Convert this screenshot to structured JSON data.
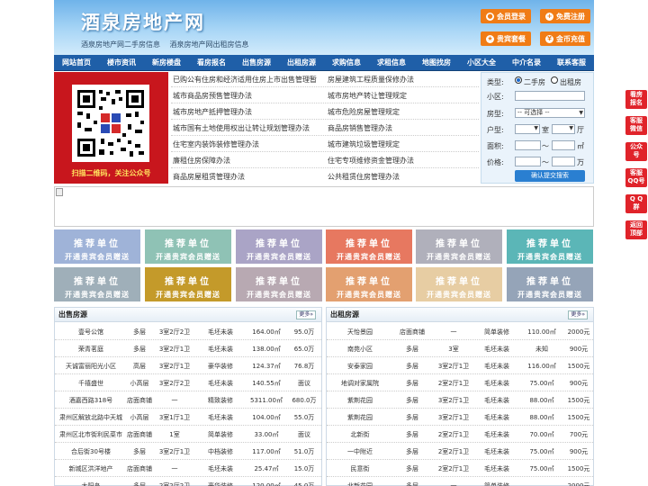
{
  "header": {
    "logo": "酒泉房地产网",
    "sublinks": [
      "酒泉房地产网二手房信息",
      "酒泉房地产网出租房信息"
    ],
    "buttons": [
      {
        "label": "会员登录",
        "icon": "user-icon"
      },
      {
        "label": "免费注册",
        "icon": "register-icon"
      },
      {
        "label": "贵宾套餐",
        "icon": "vip-icon"
      },
      {
        "label": "金币充值",
        "icon": "coin-icon"
      }
    ]
  },
  "nav": [
    "网站首页",
    "楼市资讯",
    "新房楼盘",
    "看房报名",
    "出售房源",
    "出租房源",
    "求购信息",
    "求租信息",
    "地图找房",
    "小区大全",
    "中介名录",
    "联系客服"
  ],
  "qr": {
    "caption": "扫描二维码，关注公众号"
  },
  "links": {
    "left": [
      "已购公有住房和经济适用住房上市出售管理暂",
      "城市商品房预售管理办法",
      "城市房地产抵押管理办法",
      "城市国有土地使用权出让转让规划管理办法",
      "住宅室内装饰装修管理办法",
      "廉租住房保障办法",
      "商品房屋租赁管理办法"
    ],
    "right": [
      "房屋建筑工程质量保修办法",
      "城市房地产转让管理规定",
      "城市危险房屋管理规定",
      "商品房销售管理办法",
      "城市建筑垃圾管理规定",
      "住宅专项维修资金管理办法",
      "公共租赁住房管理办法"
    ]
  },
  "search": {
    "type_label": "类型:",
    "opt1": "二手房",
    "opt2": "出租房",
    "area_label": "小区:",
    "room_label": "房型:",
    "room_select": "-- 可选择 --",
    "huxing_label": "户型:",
    "shi": "室",
    "ting": "厅",
    "mianji_label": "面积:",
    "mianji_sep": "～",
    "mianji_unit": "㎡",
    "price_label": "价格:",
    "price_sep": "～",
    "price_unit": "万",
    "submit": "确认提交搜索"
  },
  "recommend": {
    "title": "推荐单位",
    "sub": "开通贵宾会员赠送",
    "colors": [
      "#9fb3d8",
      "#8fc2b5",
      "#aaa4c6",
      "#e77860",
      "#b0b0bb",
      "#5bb6b7",
      "#9fafb9",
      "#c49a2a",
      "#b8a9b2",
      "#e3a070",
      "#e7cda3",
      "#95a4b8"
    ]
  },
  "sale": {
    "title": "出售房源",
    "more": "更多",
    "rows": [
      [
        "壹号公馆",
        "多层",
        "3室2厅2卫",
        "毛坯未装",
        "164.00㎡",
        "95.0万"
      ],
      [
        "荣青茗庭",
        "多层",
        "3室2厅1卫",
        "毛坯未装",
        "138.00㎡",
        "65.0万"
      ],
      [
        "天诚富丽阳光小区",
        "高层",
        "3室2厅1卫",
        "豪华装修",
        "124.37㎡",
        "76.8万"
      ],
      [
        "千禧盛世",
        "小高层",
        "3室2厅2卫",
        "毛坯未装",
        "140.55㎡",
        "面议"
      ],
      [
        "酒嘉西路318号",
        "店面商铺",
        "一",
        "精致装修",
        "5311.00㎡",
        "680.0万"
      ],
      [
        "肃州区解放北路中天城",
        "小高层",
        "3室1厅1卫",
        "毛坯未装",
        "104.00㎡",
        "55.0万"
      ],
      [
        "肃州区北市街利民菜市",
        "店面商铺",
        "1室",
        "简单装修",
        "33.00㎡",
        "面议"
      ],
      [
        "合后街30号楼",
        "多层",
        "3室2厅1卫",
        "中档装修",
        "117.00㎡",
        "51.0万"
      ],
      [
        "新城区洪洋地产",
        "店面商铺",
        "一",
        "毛坯未装",
        "25.47㎡",
        "15.0万"
      ],
      [
        "太阳岛",
        "多层",
        "2室2厅2卫",
        "豪华装修",
        "120.00㎡",
        "45.0万"
      ]
    ]
  },
  "rent": {
    "title": "出租房源",
    "more": "更多",
    "rows": [
      [
        "天怡景园",
        "店面商铺",
        "一",
        "简单装修",
        "110.00㎡",
        "2000元"
      ],
      [
        "南苑小区",
        "多层",
        "3室",
        "毛坯未装",
        "未知",
        "900元"
      ],
      [
        "安泰家园",
        "多层",
        "3室2厅1卫",
        "毛坯未装",
        "116.00㎡",
        "1500元"
      ],
      [
        "地调对家属院",
        "多层",
        "2室2厅1卫",
        "毛坯未装",
        "75.00㎡",
        "900元"
      ],
      [
        "紫荆花园",
        "多层",
        "3室2厅1卫",
        "毛坯未装",
        "88.00㎡",
        "1500元"
      ],
      [
        "紫荆花园",
        "多层",
        "3室2厅1卫",
        "毛坯未装",
        "88.00㎡",
        "1500元"
      ],
      [
        "北新街",
        "多层",
        "2室2厅1卫",
        "毛坯未装",
        "70.00㎡",
        "700元"
      ],
      [
        "一中附近",
        "多层",
        "2室2厅1卫",
        "毛坯未装",
        "75.00㎡",
        "900元"
      ],
      [
        "民意街",
        "多层",
        "2室2厅1卫",
        "毛坯未装",
        "75.00㎡",
        "1500元"
      ],
      [
        "北新花园",
        "多层",
        "一",
        "简单装修",
        "",
        "2000元"
      ]
    ]
  },
  "float": [
    "看房\n报名",
    "客服\n微信",
    "公众\n号",
    "客服\nQQ号",
    "Q Q\n群",
    "返回\n顶部"
  ]
}
